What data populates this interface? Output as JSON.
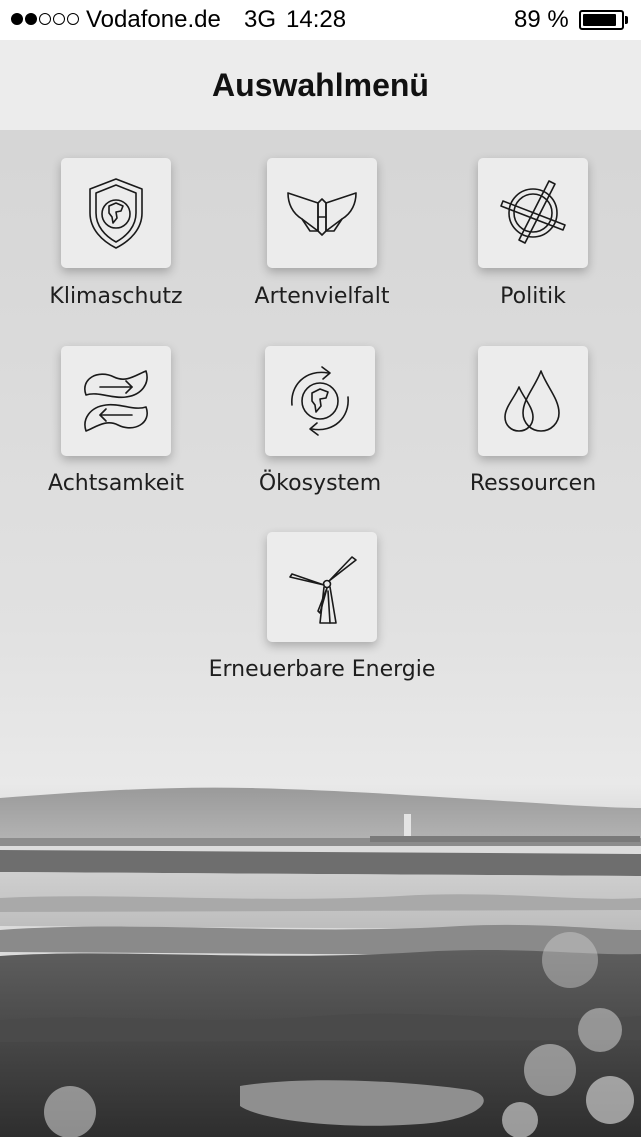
{
  "status_bar": {
    "carrier": "Vodafone.de",
    "network": "3G",
    "time": "14:28",
    "battery": "89 %",
    "battery_level": 0.89,
    "signal_bars_filled": 2,
    "signal_bars_total": 5
  },
  "header": {
    "title": "Auswahlmenü"
  },
  "menu": {
    "items": [
      {
        "label": "Klimaschutz",
        "icon": "shield-globe-icon"
      },
      {
        "label": "Artenvielfalt",
        "icon": "butterfly-icon"
      },
      {
        "label": "Politik",
        "icon": "ballot-cross-icon"
      },
      {
        "label": "Achtsamkeit",
        "icon": "yin-yang-leaves-icon"
      },
      {
        "label": "Ökosystem",
        "icon": "globe-cycle-icon"
      },
      {
        "label": "Ressourcen",
        "icon": "water-drops-icon"
      },
      {
        "label": "Erneuerbare Energie",
        "icon": "wind-turbine-icon"
      }
    ]
  }
}
